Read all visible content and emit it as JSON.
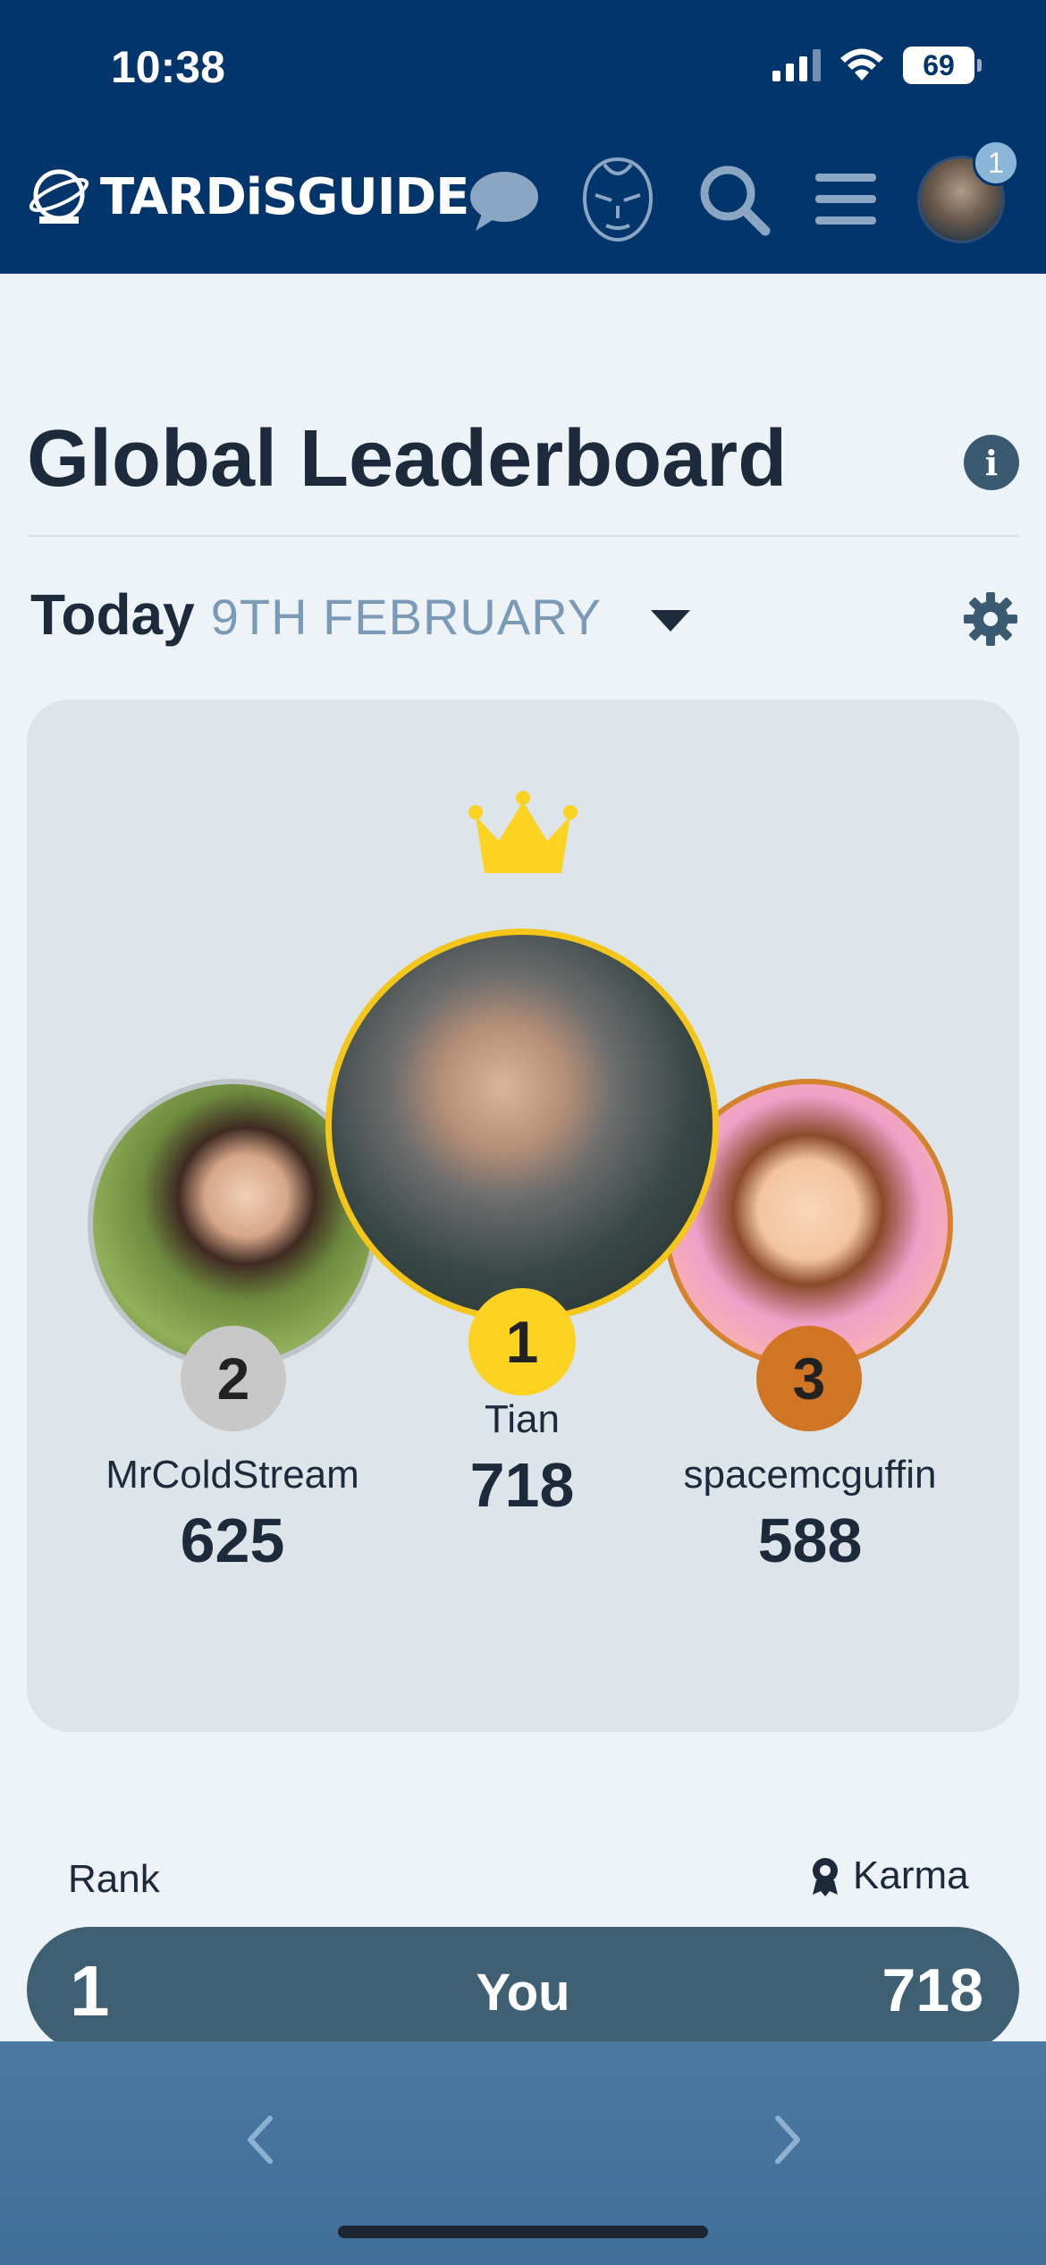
{
  "status": {
    "time": "10:38",
    "battery": "69"
  },
  "nav": {
    "logo_text": "TARDiSGUIDE",
    "notification_count": "1"
  },
  "page": {
    "title": "Global Leaderboard",
    "date_label": "Today",
    "date_value": "9TH FEBRUARY"
  },
  "podium": {
    "first": {
      "rank": "1",
      "name": "Tian",
      "score": "718"
    },
    "second": {
      "rank": "2",
      "name": "MrColdStream",
      "score": "625"
    },
    "third": {
      "rank": "3",
      "name": "spacemcguffin",
      "score": "588"
    }
  },
  "table": {
    "rank_header": "Rank",
    "karma_header": "Karma",
    "me": {
      "rank": "1",
      "name": "You",
      "score": "718"
    }
  },
  "colors": {
    "brand_dark": "#01356c",
    "gold": "#fcd321",
    "silver": "#c8c8c8",
    "bronze": "#cf7523"
  },
  "icons": [
    "chat-icon",
    "villain-face-icon",
    "search-icon",
    "menu-icon",
    "info-icon",
    "gear-icon",
    "crown-icon",
    "award-icon",
    "chevron-left-icon",
    "chevron-right-icon"
  ]
}
